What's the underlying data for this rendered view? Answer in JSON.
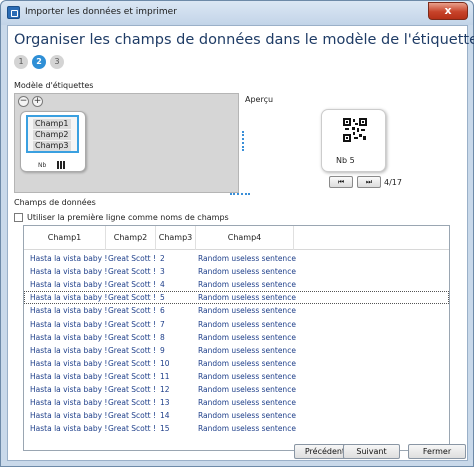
{
  "window": {
    "title": "Importer les données et imprimer",
    "close_glyph": "x"
  },
  "heading": "Organiser les champs de données dans le modèle de l'étiquette",
  "steps": [
    {
      "label": "1",
      "active": false
    },
    {
      "label": "2",
      "active": true
    },
    {
      "label": "3",
      "active": false
    }
  ],
  "model": {
    "section_label": "Modèle d'étiquettes",
    "zoom_out_glyph": "−",
    "zoom_in_glyph": "+",
    "fields": [
      "Champ1",
      "Champ2",
      "Champ3"
    ],
    "mini_text": "Nb"
  },
  "preview": {
    "section_label": "Aperçu",
    "text": "Nb 5",
    "first_glyph": "⏮",
    "next_glyph": "⏭",
    "page": "4/17"
  },
  "data": {
    "section_label": "Champs de données",
    "checkbox_label": "Utiliser la première ligne comme noms de champs",
    "columns": [
      "Champ1",
      "Champ2",
      "Champ3",
      "Champ4"
    ],
    "rows": [
      [
        "Hasta la vista baby !",
        "Great Scott !",
        "2",
        "Random useless sentence"
      ],
      [
        "Hasta la vista baby !",
        "Great Scott !",
        "3",
        "Random useless sentence"
      ],
      [
        "Hasta la vista baby !",
        "Great Scott !",
        "4",
        "Random useless sentence"
      ],
      [
        "Hasta la vista baby !",
        "Great Scott !",
        "5",
        "Random useless sentence"
      ],
      [
        "Hasta la vista baby !",
        "Great Scott !",
        "6",
        "Random useless sentence"
      ],
      [
        "Hasta la vista baby !",
        "Great Scott !",
        "7",
        "Random useless sentence"
      ],
      [
        "Hasta la vista baby !",
        "Great Scott !",
        "8",
        "Random useless sentence"
      ],
      [
        "Hasta la vista baby !",
        "Great Scott !",
        "9",
        "Random useless sentence"
      ],
      [
        "Hasta la vista baby !",
        "Great Scott !",
        "10",
        "Random useless sentence"
      ],
      [
        "Hasta la vista baby !",
        "Great Scott !",
        "11",
        "Random useless sentence"
      ],
      [
        "Hasta la vista baby !",
        "Great Scott !",
        "12",
        "Random useless sentence"
      ],
      [
        "Hasta la vista baby !",
        "Great Scott !",
        "13",
        "Random useless sentence"
      ],
      [
        "Hasta la vista baby !",
        "Great Scott !",
        "14",
        "Random useless sentence"
      ],
      [
        "Hasta la vista baby !",
        "Great Scott !",
        "15",
        "Random useless sentence"
      ]
    ],
    "focused_row": 3
  },
  "buttons": {
    "previous": "Précédent",
    "next": "Suivant",
    "close": "Fermer"
  }
}
